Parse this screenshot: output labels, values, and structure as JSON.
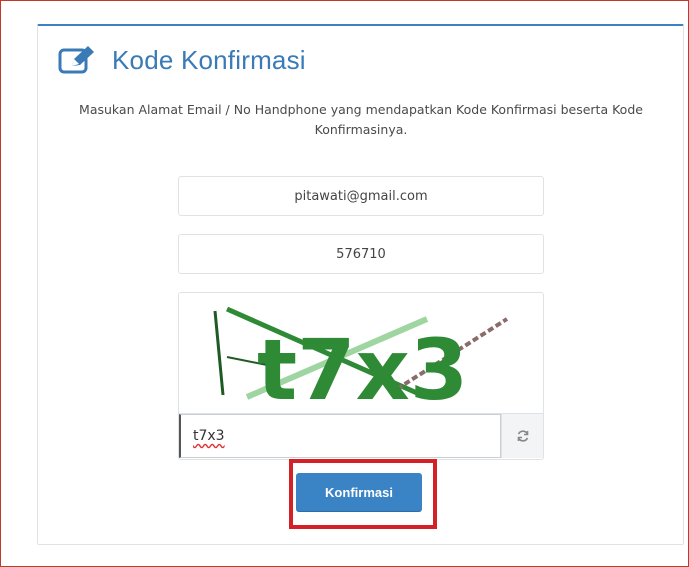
{
  "page": {
    "title": "Kode Konfirmasi",
    "title_icon": "edit-pencil-icon",
    "description": "Masukan Alamat Email / No Handphone yang mendapatkan Kode Konfirmasi beserta Kode Konfirmasinya."
  },
  "form": {
    "email_value": "pitawati@gmail.com",
    "code_value": "576710",
    "captcha_text_image": "t7x3",
    "captcha_input_value": "t7x3",
    "refresh_icon": "refresh-icon",
    "submit_label": "Konfirmasi"
  },
  "colors": {
    "accent": "#3a83c5",
    "title": "#3a7ab6",
    "highlight": "#d42027",
    "captcha_green": "#2f8a36"
  }
}
